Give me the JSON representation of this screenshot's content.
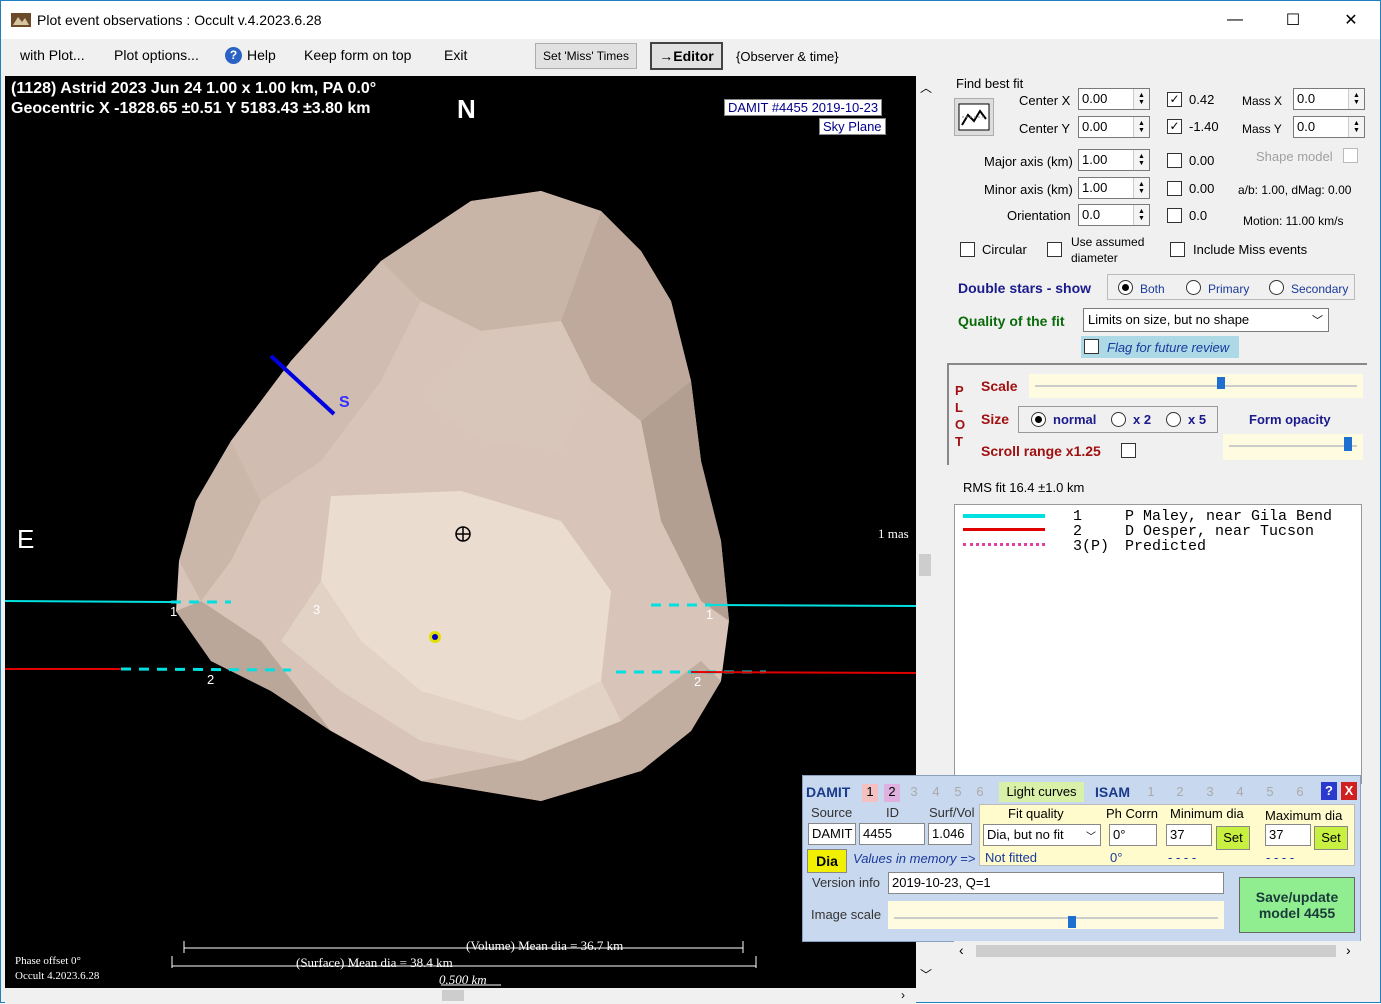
{
  "titlebar": {
    "title": "Plot event observations : Occult v.4.2023.6.28",
    "minimize": "—",
    "maximize": "☐",
    "close": "✕"
  },
  "menu": {
    "with_plot": "with Plot...",
    "plot_options": "Plot options...",
    "help": "Help",
    "keep_on_top": "Keep form on top",
    "exit": "Exit",
    "set_miss_times": "Set 'Miss' Times",
    "editor": "→Editor",
    "observer_time": "{Observer & time}"
  },
  "plot": {
    "header1": "(1128) Astrid  2023 Jun 24   1.00 x 1.00 km, PA 0.0°",
    "header2": "Geocentric  X  -1828.65 ±0.51  Y 5183.43 ±3.80 km",
    "north": "N",
    "east": "E",
    "south_marker": "S",
    "damit_label": "DAMIT #4455 2019-10-23",
    "sky_plane": "Sky Plane",
    "mas_label": "1 mas",
    "chord_labels": [
      "1",
      "3",
      "1",
      "2",
      "2"
    ],
    "volume_dia": "(Volume) Mean dia = 36.7 km",
    "surface_dia": "(Surface) Mean dia = 38.4 km",
    "scale_km": "0.500 km",
    "phase_offset": "Phase offset 0°",
    "occult_version": "Occult 4.2023.6.28"
  },
  "fit": {
    "group_title": "Find best fit",
    "center_x_label": "Center X",
    "center_x": "0.00",
    "center_y_label": "Center Y",
    "center_y": "0.00",
    "chk_center_x": "0.42",
    "chk_center_y": "-1.40",
    "mass_x_label": "Mass X",
    "mass_x": "0.0",
    "mass_y_label": "Mass Y",
    "mass_y": "0.0",
    "major_label": "Major axis (km)",
    "major": "1.00",
    "chk_major": "0.00",
    "minor_label": "Minor axis (km)",
    "minor": "1.00",
    "chk_minor": "0.00",
    "orient_label": "Orientation",
    "orient": "0.0",
    "chk_orient": "0.0",
    "shape_model": "Shape model",
    "ab_dmag": "a/b: 1.00, dMag: 0.00",
    "motion": "Motion: 11.00 km/s",
    "circular": "Circular",
    "use_assumed_1": "Use assumed",
    "use_assumed_2": "diameter",
    "include_miss": "Include Miss events",
    "double_stars": "Double stars - show",
    "both": "Both",
    "primary": "Primary",
    "secondary": "Secondary",
    "quality_label": "Quality of the fit",
    "quality_value": "Limits on size, but no shape",
    "flag_review": "Flag for future review"
  },
  "plotopts": {
    "plot_letters": [
      "P",
      "L",
      "O",
      "T"
    ],
    "scale": "Scale",
    "size": "Size",
    "normal": "normal",
    "x2": "x 2",
    "x5": "x 5",
    "form_opacity": "Form opacity",
    "scroll_range": "Scroll range x1.25",
    "scale_level": 0.58,
    "opacity_level": 0.96
  },
  "legend": {
    "rms": "RMS fit 16.4 ±1.0 km",
    "rows": [
      {
        "num": "1",
        "name": "P Maley, near Gila Bend",
        "color": "#00e0e0"
      },
      {
        "num": "2",
        "name": "D Oesper, near Tucson",
        "color": "#e00000"
      },
      {
        "num": "3(P)",
        "name": "Predicted",
        "color": "#e040a0"
      }
    ]
  },
  "damit": {
    "damit": "DAMIT",
    "damit_nums": [
      "1",
      "2",
      "3",
      "4",
      "5",
      "6"
    ],
    "light_curves": "Light curves",
    "isam": "ISAM",
    "isam_nums": [
      "1",
      "2",
      "3",
      "4",
      "5",
      "6"
    ],
    "help_q": "?",
    "close_x": "X",
    "source_label": "Source",
    "source": "DAMIT",
    "id_label": "ID",
    "id": "4455",
    "surfvol_label": "Surf/Vol",
    "surfvol": "1.046",
    "fitq_label": "Fit quality",
    "fitq": "Dia, but no fit",
    "phcorr_label": "Ph Corrn",
    "phcorr": "0°",
    "mindia_label": "Minimum dia",
    "mindia": "37",
    "maxdia_label": "Maximum dia",
    "maxdia": "37",
    "set": "Set",
    "dia": "Dia",
    "values_mem": "Values in memory =>",
    "not_fitted": "Not fitted",
    "ph_mem": "0°",
    "dashes1": "- - - -",
    "dashes2": "- - - -",
    "version_label": "Version info",
    "version": "2019-10-23, Q=1",
    "image_scale": "Image scale",
    "save_btn": "Save/update model 4455",
    "image_scale_level": 0.55
  },
  "colors": {
    "chord1": "#00e0e0",
    "chord2": "#e00000",
    "predicted": "#e040a0",
    "asteroid": "#d8c4b8"
  }
}
